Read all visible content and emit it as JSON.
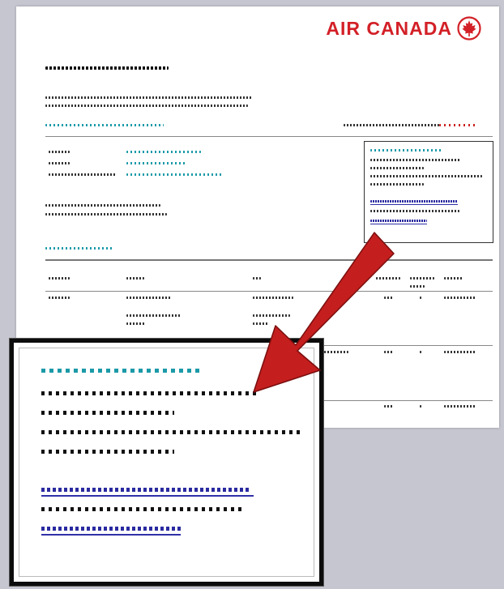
{
  "document": {
    "brand_name": "AIR CANADA",
    "brand_logo_icon": "maple-leaf-roundel-icon",
    "brand_color": "#d32027"
  },
  "callout": {
    "arrow_color": "#c41e1e"
  }
}
